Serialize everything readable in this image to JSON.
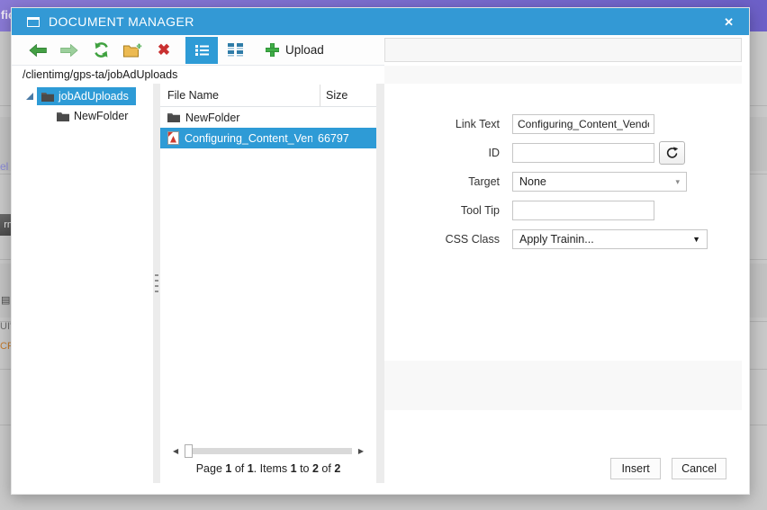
{
  "backdrop": {
    "top_bar_text": "fic",
    "fragments": {
      "link": "el",
      "button": "rn",
      "icon": "▤",
      "ui": "UI'",
      "cr": "CRI"
    }
  },
  "icons": {
    "close": "✕",
    "delete": "✖",
    "scroll_left": "◀",
    "scroll_right": "▶",
    "select_arrow_light": "▾",
    "select_arrow_dark": "▼"
  },
  "dialog": {
    "title": "DOCUMENT MANAGER",
    "toolbar": {
      "upload_label": "Upload"
    },
    "path": "/clientimg/gps-ta/jobAdUploads",
    "tree": {
      "items": [
        {
          "label": "jobAdUploads",
          "selected": true,
          "expanded": true
        },
        {
          "label": "NewFolder",
          "selected": false
        }
      ]
    },
    "file_list": {
      "columns": {
        "name": "File Name",
        "size": "Size"
      },
      "rows": [
        {
          "name": "NewFolder",
          "size": "",
          "type": "folder",
          "selected": false
        },
        {
          "name": "Configuring_Content_Vendor",
          "size": "66797",
          "type": "pdf",
          "selected": true
        }
      ]
    },
    "pagination": [
      "Page ",
      "1",
      " of ",
      "1",
      ". Items ",
      "1",
      " to ",
      "2",
      " of ",
      "2"
    ],
    "form": {
      "fields": [
        {
          "label": "Link Text",
          "value": "Configuring_Content_Vendor",
          "type": "text"
        },
        {
          "label": "ID",
          "value": "",
          "type": "text-with-reset"
        },
        {
          "label": "Target",
          "value": "None",
          "type": "select"
        },
        {
          "label": "Tool Tip",
          "value": "",
          "type": "text"
        },
        {
          "label": "CSS Class",
          "value": "Apply Trainin...",
          "type": "select"
        }
      ]
    },
    "buttons": {
      "insert": "Insert",
      "cancel": "Cancel"
    },
    "colors": {
      "titlebar": "#3399d5",
      "selection": "#2e9bd6",
      "toolbar_green": "#3fa13f",
      "folder_yellow": "#ecba52",
      "delete_red": "#c93030"
    }
  }
}
